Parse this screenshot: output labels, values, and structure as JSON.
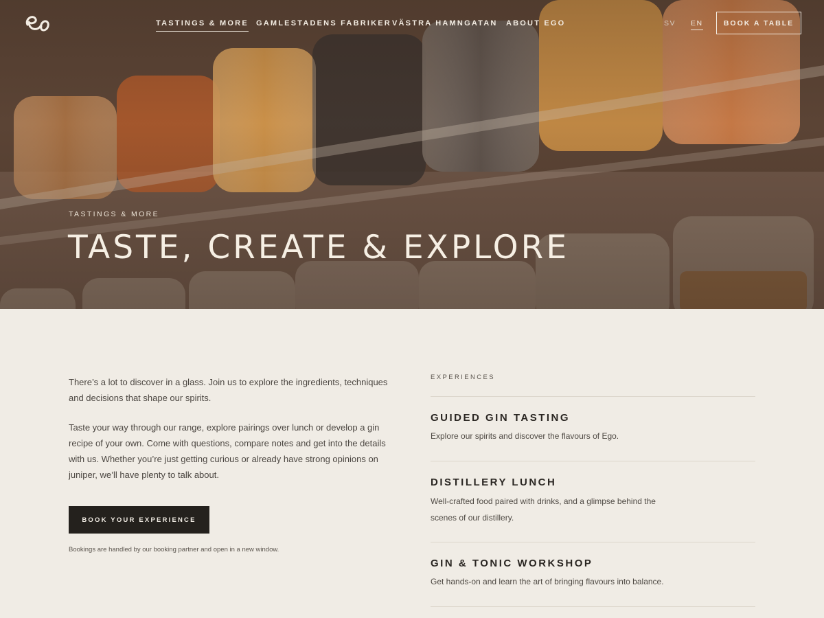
{
  "nav": {
    "items": [
      {
        "label": "TASTINGS & MORE",
        "active": true
      },
      {
        "label": "GAMLESTADENS FABRIKER",
        "active": false
      },
      {
        "label": "VÄSTRA HAMNGATAN",
        "active": false
      },
      {
        "label": "ABOUT EGO",
        "active": false
      }
    ],
    "languages": [
      {
        "label": "SV",
        "active": false
      },
      {
        "label": "EN",
        "active": true
      }
    ],
    "book_table_label": "BOOK A TABLE"
  },
  "hero": {
    "eyebrow": "TASTINGS & MORE",
    "title": "TASTE, CREATE & EXPLORE"
  },
  "intro": {
    "paragraphs": [
      "There’s a lot to discover in a glass. Join us to explore the ingredients, techniques and decisions that shape our spirits.",
      "Taste your way through our range, explore pairings over lunch or develop a gin recipe of your own. Come with questions, compare notes and get into the details with us. Whether you’re just getting curious or already have strong opinions on juniper, we’ll have plenty to talk about."
    ],
    "book_button_label": "BOOK YOUR EXPERIENCE",
    "booking_note": "Bookings are handled by our booking partner and open in a new window."
  },
  "experiences": {
    "heading": "EXPERIENCES",
    "items": [
      {
        "title": "GUIDED GIN TASTING",
        "description": "Explore our spirits and discover the flavours of Ego."
      },
      {
        "title": "DISTILLERY LUNCH",
        "description": "Well-crafted food paired with drinks, and a glimpse behind the scenes of our distillery."
      },
      {
        "title": "GIN & TONIC WORKSHOP",
        "description": "Get hands-on and learn the art of bringing flavours into balance."
      }
    ]
  },
  "colors": {
    "background": "#f0ece5",
    "dark_button": "#24211d",
    "hero_text": "#f6efe4"
  }
}
